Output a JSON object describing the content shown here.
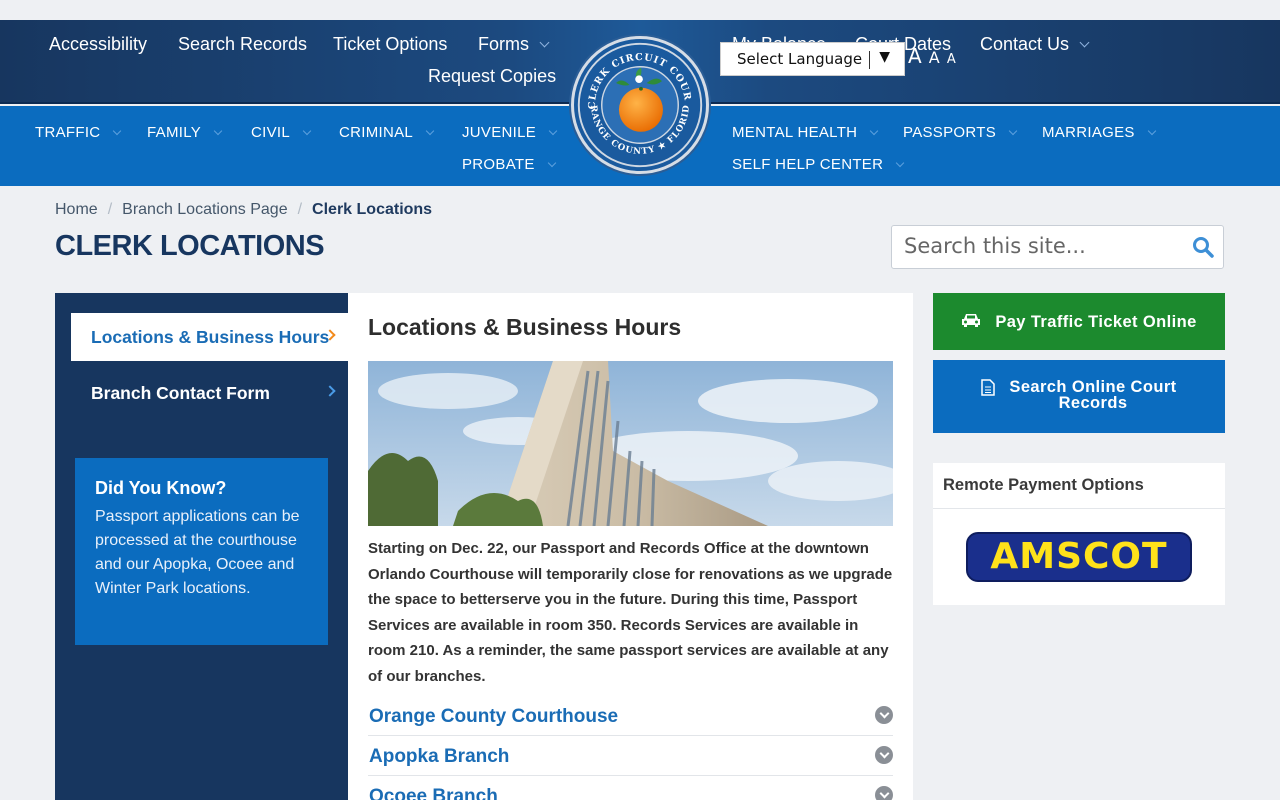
{
  "header": {
    "upper_left": [
      "Accessibility",
      "Search Records",
      "Ticket Options",
      "Forms",
      "Request Copies"
    ],
    "upper_right": [
      "My Balance",
      "Court Dates",
      "Contact Us"
    ],
    "language_select": "Select Language",
    "font_sizes": [
      "A",
      "A",
      "A"
    ],
    "seal": {
      "top_text": "CLERK CIRCUIT COURT",
      "bottom_text": "ORANGE COUNTY ★ FLORIDA"
    },
    "lower_left": [
      "TRAFFIC",
      "FAMILY",
      "CIVIL",
      "CRIMINAL",
      "JUVENILE",
      "PROBATE"
    ],
    "lower_right": [
      "MENTAL HEALTH",
      "PASSPORTS",
      "MARRIAGES",
      "SELF HELP CENTER"
    ]
  },
  "breadcrumb": {
    "home": "Home",
    "parent": "Branch Locations Page",
    "current": "Clerk Locations",
    "separator": "/"
  },
  "page_title": "CLERK LOCATIONS",
  "search": {
    "placeholder": "Search this site..."
  },
  "sidebar": {
    "items": [
      "Locations & Business Hours",
      "Branch Contact Form"
    ],
    "did_you_know": {
      "title": "Did You Know?",
      "text": "Passport applications can be processed at the courthouse and our Apopka, Ocoee and Winter Park locations."
    }
  },
  "main": {
    "heading": "Locations & Business Hours",
    "notice": "Starting on Dec. 22, our Passport and Records Office at the downtown Orlando Courthouse will temporarily close for renovations as we upgrade the space to betterserve you in the future. During this time, Passport Services are available in room 350. Records Services are available in room 210.  As a reminder, the same passport services are available at any of our branches.",
    "accordions": [
      "Orange County Courthouse",
      "Apopka Branch",
      "Ocoee Branch"
    ]
  },
  "right": {
    "pay_button": "Pay Traffic Ticket Online",
    "records_button_line1": "Search Online Court",
    "records_button_line2": "Records",
    "remote_title": "Remote Payment Options",
    "amscot": "AMSCOT"
  },
  "colors": {
    "navy": "#17365f",
    "blue": "#0b6cbf",
    "green": "#1c8a2e",
    "orange": "#f28a1c"
  }
}
